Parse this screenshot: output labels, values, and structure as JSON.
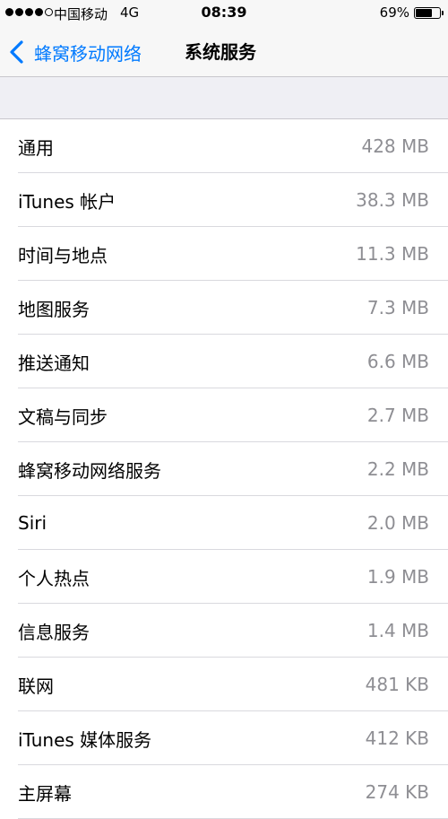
{
  "status_bar": {
    "carrier": "中国移动",
    "network": "4G",
    "time": "08:39",
    "battery_percent": "69%",
    "battery_level": 0.69
  },
  "nav": {
    "back_label": "蜂窝移动网络",
    "title": "系统服务"
  },
  "items": [
    {
      "label": "通用",
      "size": "428 MB"
    },
    {
      "label": "iTunes 帐户",
      "size": "38.3 MB"
    },
    {
      "label": "时间与地点",
      "size": "11.3 MB"
    },
    {
      "label": "地图服务",
      "size": "7.3 MB"
    },
    {
      "label": "推送通知",
      "size": "6.6 MB"
    },
    {
      "label": "文稿与同步",
      "size": "2.7 MB"
    },
    {
      "label": "蜂窝移动网络服务",
      "size": "2.2 MB"
    },
    {
      "label": "Siri",
      "size": "2.0 MB"
    },
    {
      "label": "个人热点",
      "size": "1.9 MB"
    },
    {
      "label": "信息服务",
      "size": "1.4 MB"
    },
    {
      "label": "联网",
      "size": "481 KB"
    },
    {
      "label": "iTunes 媒体服务",
      "size": "412 KB"
    },
    {
      "label": "主屏幕",
      "size": "274 KB"
    }
  ],
  "colors": {
    "accent": "#007aff",
    "secondary_text": "#8e8e93",
    "background": "#efeff4"
  }
}
